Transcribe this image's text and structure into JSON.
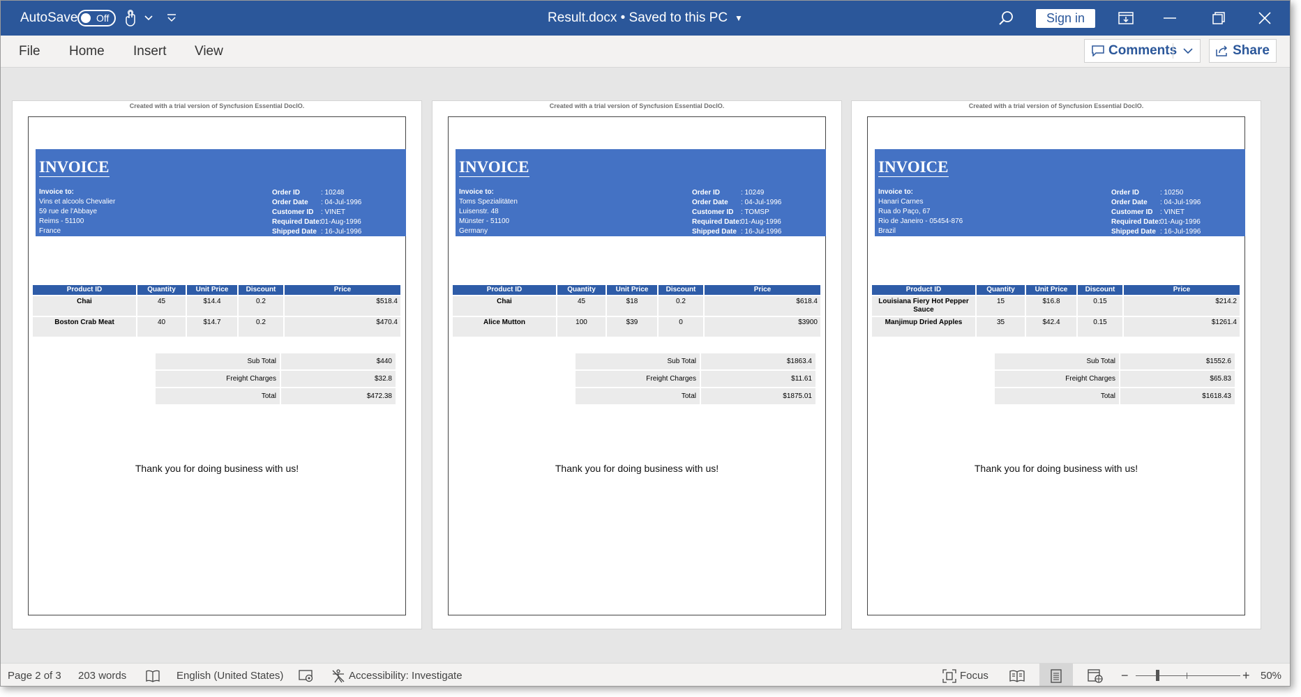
{
  "titlebar": {
    "autosave_label": "AutoSave",
    "autosave_state": "Off",
    "doc_title": "Result.docx • Saved to this PC",
    "sign_in": "Sign in"
  },
  "menu": {
    "tabs": [
      "File",
      "Home",
      "Insert",
      "View"
    ],
    "comments_label": "Comments",
    "share_label": "Share"
  },
  "watermark": "Created with a trial version of Syncfusion Essential DocIO.",
  "invoice_labels": {
    "title": "INVOICE",
    "invoice_to": "Invoice to:",
    "order_id": "Order ID",
    "order_date": "Order Date",
    "customer_id": "Customer ID",
    "required_date": "Required Date:",
    "shipped_date": "Shipped Date",
    "col_product": "Product ID",
    "col_quantity": "Quantity",
    "col_unit_price": "Unit Price",
    "col_discount": "Discount",
    "col_price": "Price",
    "sub_total": "Sub Total",
    "freight": "Freight Charges",
    "total": "Total",
    "thanks": "Thank you for doing business with us!"
  },
  "pages": [
    {
      "to": [
        "Vins et alcools Chevalier",
        "59 rue de l'Abbaye",
        "Reims - 51100",
        "France"
      ],
      "order_id": ": 10248",
      "order_date": ": 04-Jul-1996",
      "customer_id": ": VINET",
      "required_date": " 01-Aug-1996",
      "shipped_date": ": 16-Jul-1996",
      "items": [
        {
          "name": "Chai",
          "qty": "45",
          "unit": "$14.4",
          "disc": "0.2",
          "price": "$518.4"
        },
        {
          "name": "Boston Crab Meat",
          "qty": "40",
          "unit": "$14.7",
          "disc": "0.2",
          "price": "$470.4"
        }
      ],
      "sub_total": "$440",
      "freight": "$32.8",
      "total": "$472.38"
    },
    {
      "to": [
        "Toms Spezialitäten",
        "Luisenstr. 48",
        "Münster - 51100",
        "Germany"
      ],
      "order_id": ": 10249",
      "order_date": ": 04-Jul-1996",
      "customer_id": ": TOMSP",
      "required_date": " 01-Aug-1996",
      "shipped_date": ": 16-Jul-1996",
      "items": [
        {
          "name": "Chai",
          "qty": "45",
          "unit": "$18",
          "disc": "0.2",
          "price": "$618.4"
        },
        {
          "name": "Alice Mutton",
          "qty": "100",
          "unit": "$39",
          "disc": "0",
          "price": "$3900"
        }
      ],
      "sub_total": "$1863.4",
      "freight": "$11.61",
      "total": "$1875.01"
    },
    {
      "to": [
        "Hanari Carnes",
        "Rua do Paço, 67",
        "Rio de Janeiro - 05454-876",
        "Brazil"
      ],
      "order_id": ": 10250",
      "order_date": ": 04-Jul-1996",
      "customer_id": ": VINET",
      "required_date": " 01-Aug-1996",
      "shipped_date": ": 16-Jul-1996",
      "items": [
        {
          "name": "Louisiana Fiery Hot Pepper Sauce",
          "qty": "15",
          "unit": "$16.8",
          "disc": "0.15",
          "price": "$214.2"
        },
        {
          "name": "Manjimup Dried Apples",
          "qty": "35",
          "unit": "$42.4",
          "disc": "0.15",
          "price": "$1261.4"
        }
      ],
      "sub_total": "$1552.6",
      "freight": "$65.83",
      "total": "$1618.43"
    }
  ],
  "status": {
    "page": "Page 2 of 3",
    "words": "203 words",
    "language": "English (United States)",
    "accessibility": "Accessibility: Investigate",
    "focus": "Focus",
    "zoom": "50%"
  }
}
